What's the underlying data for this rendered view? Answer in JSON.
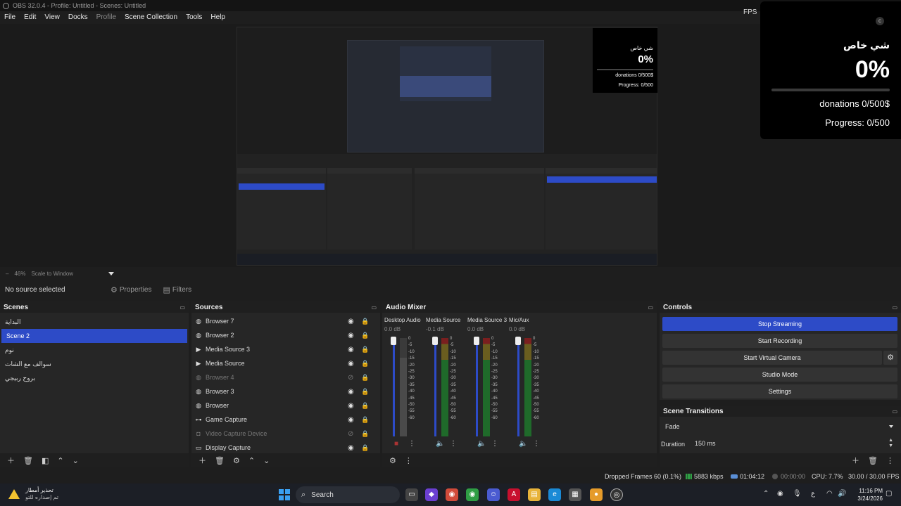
{
  "window": {
    "title": "OBS 32.0.4 - Profile: Untitled - Scenes: Untitled",
    "fps_label": "FPS"
  },
  "menu": {
    "file": "File",
    "edit": "Edit",
    "view": "View",
    "docks": "Docks",
    "profile": "Profile",
    "scene_collection": "Scene Collection",
    "tools": "Tools",
    "help": "Help"
  },
  "overlay": {
    "title": "شي خاص",
    "percent": "0%",
    "progress_fraction": 0,
    "donations": "donations 0/500$",
    "progress": "Progress: 0/500"
  },
  "nested_overlay": {
    "title": "شي خاص",
    "percent": "0%",
    "donations": "donations 0/500$",
    "progress": "Progress: 0/500"
  },
  "zoom": {
    "level": "46%",
    "mode": "Scale to Window"
  },
  "source_toolbar": {
    "status": "No source selected",
    "properties": "Properties",
    "filters": "Filters"
  },
  "scenes": {
    "title": "Scenes",
    "items": [
      "البداية",
      "Scene 2",
      "نوم",
      "سوالف مع الشات",
      "بروح ربيجي"
    ],
    "selected_index": 1
  },
  "sources": {
    "title": "Sources",
    "items": [
      {
        "name": "Browser 7",
        "icon": "globe-icon",
        "visible": true
      },
      {
        "name": "Browser 2",
        "icon": "globe-icon",
        "visible": true
      },
      {
        "name": "Media Source 3",
        "icon": "play-icon",
        "visible": true
      },
      {
        "name": "Media Source",
        "icon": "play-icon",
        "visible": true
      },
      {
        "name": "Browser 4",
        "icon": "globe-icon",
        "visible": false
      },
      {
        "name": "Browser 3",
        "icon": "globe-icon",
        "visible": true
      },
      {
        "name": "Browser",
        "icon": "globe-icon",
        "visible": true
      },
      {
        "name": "Game Capture",
        "icon": "gamepad-icon",
        "visible": true
      },
      {
        "name": "Video Capture Device",
        "icon": "camera-icon",
        "visible": false
      },
      {
        "name": "Display Capture",
        "icon": "monitor-icon",
        "visible": true
      }
    ]
  },
  "mixer": {
    "title": "Audio Mixer",
    "ticks": [
      "0",
      "-5",
      "-10",
      "-15",
      "-20",
      "-25",
      "-30",
      "-35",
      "-40",
      "-45",
      "-50",
      "-55",
      "-60"
    ],
    "channels": [
      {
        "name": "Desktop Audio",
        "db": "0.0 dB",
        "muted": true
      },
      {
        "name": "Media Source",
        "db": "-0.1 dB",
        "muted": false
      },
      {
        "name": "Media Source 3",
        "db": "0.0 dB",
        "muted": false
      },
      {
        "name": "Mic/Aux",
        "db": "0.0 dB",
        "muted": false
      }
    ]
  },
  "controls": {
    "title": "Controls",
    "stop_streaming": "Stop Streaming",
    "start_recording": "Start Recording",
    "start_virtual_camera": "Start Virtual Camera",
    "studio_mode": "Studio Mode",
    "settings": "Settings"
  },
  "transitions": {
    "title": "Scene Transitions",
    "selected": "Fade",
    "duration_label": "Duration",
    "duration_value": "150 ms"
  },
  "status": {
    "dropped_frames": "Dropped Frames 60 (0.1%)",
    "bitrate": "5883 kbps",
    "stream_time": "01:04:12",
    "record_time": "00:00:00",
    "cpu": "CPU: 7.7%",
    "fps": "30.00 / 30.00 FPS"
  },
  "taskbar": {
    "weather_title": "تحذير أمطار",
    "weather_sub": "تم إصداره للتو",
    "search": "Search",
    "lang": "ع",
    "time": "11:16 PM",
    "date": "3/24/2026"
  },
  "colors": {
    "accent": "#2d4bc7",
    "panel": "#262626",
    "background": "#1e1e1e"
  }
}
